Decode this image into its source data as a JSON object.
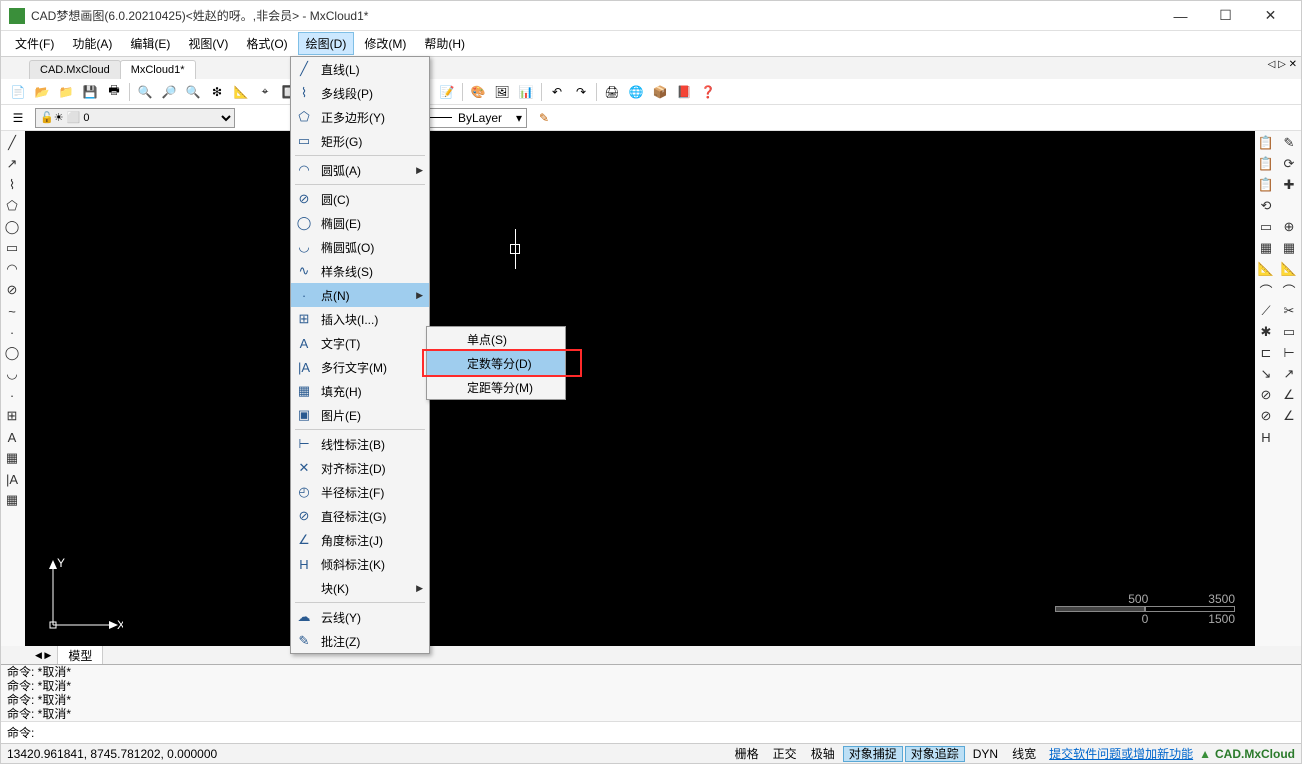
{
  "title": "CAD梦想画图(6.0.20210425)<姓赵的呀。,非会员> - MxCloud1*",
  "menubar": [
    "文件(F)",
    "功能(A)",
    "编辑(E)",
    "视图(V)",
    "格式(O)",
    "绘图(D)",
    "修改(M)",
    "帮助(H)"
  ],
  "active_menu_index": 5,
  "tabs": [
    "CAD.MxCloud",
    "MxCloud1*"
  ],
  "active_tab_index": 1,
  "layer": {
    "current": "0",
    "linetype": "ByLayer"
  },
  "draw_menu": [
    {
      "icon": "╱",
      "label": "直线(L)"
    },
    {
      "icon": "⌇",
      "label": "多线段(P)"
    },
    {
      "icon": "⬠",
      "label": "正多边形(Y)"
    },
    {
      "icon": "▭",
      "label": "矩形(G)"
    },
    {
      "sep": true
    },
    {
      "icon": "◠",
      "label": "圆弧(A)",
      "sub": true
    },
    {
      "sep": true
    },
    {
      "icon": "⊘",
      "label": "圆(C)"
    },
    {
      "icon": "◯",
      "label": "椭圆(E)"
    },
    {
      "icon": "◡",
      "label": "椭圆弧(O)"
    },
    {
      "icon": "∿",
      "label": "样条线(S)"
    },
    {
      "icon": "·",
      "label": "点(N)",
      "sub": true,
      "active": true
    },
    {
      "icon": "⊞",
      "label": "插入块(I...)"
    },
    {
      "icon": "A",
      "label": "文字(T)"
    },
    {
      "icon": "|A",
      "label": "多行文字(M)"
    },
    {
      "icon": "▦",
      "label": "填充(H)"
    },
    {
      "icon": "▣",
      "label": "图片(E)"
    },
    {
      "sep": true
    },
    {
      "icon": "⊢",
      "label": "线性标注(B)"
    },
    {
      "icon": "✕",
      "label": "对齐标注(D)"
    },
    {
      "icon": "◴",
      "label": "半径标注(F)"
    },
    {
      "icon": "⊘",
      "label": "直径标注(G)"
    },
    {
      "icon": "∠",
      "label": "角度标注(J)"
    },
    {
      "icon": "H",
      "label": "倾斜标注(K)"
    },
    {
      "icon": " ",
      "label": "块(K)",
      "sub": true
    },
    {
      "sep": true
    },
    {
      "icon": "☁",
      "label": "云线(Y)"
    },
    {
      "icon": "✎",
      "label": "批注(Z)"
    }
  ],
  "point_submenu": [
    {
      "label": "单点(S)"
    },
    {
      "label": "定数等分(D)",
      "active": true
    },
    {
      "label": "定距等分(M)"
    }
  ],
  "scale": {
    "top_left": "500",
    "top_right": "3500",
    "bot_left": "0",
    "bot_right": "1500"
  },
  "bottom_tab": "模型",
  "cmd_history": [
    "命令:   *取消*",
    "命令:   *取消*",
    "命令:   *取消*",
    "命令:   *取消*"
  ],
  "cmd_prompt": "命令:",
  "status": {
    "coords": "13420.961841,  8745.781202,  0.000000",
    "buttons": [
      {
        "t": "栅格",
        "a": false
      },
      {
        "t": "正交",
        "a": false
      },
      {
        "t": "极轴",
        "a": false
      },
      {
        "t": "对象捕捉",
        "a": true
      },
      {
        "t": "对象追踪",
        "a": true
      },
      {
        "t": "DYN",
        "a": false
      },
      {
        "t": "线宽",
        "a": false
      }
    ],
    "link": "提交软件问题或增加新功能",
    "product": "CAD.MxCloud"
  }
}
